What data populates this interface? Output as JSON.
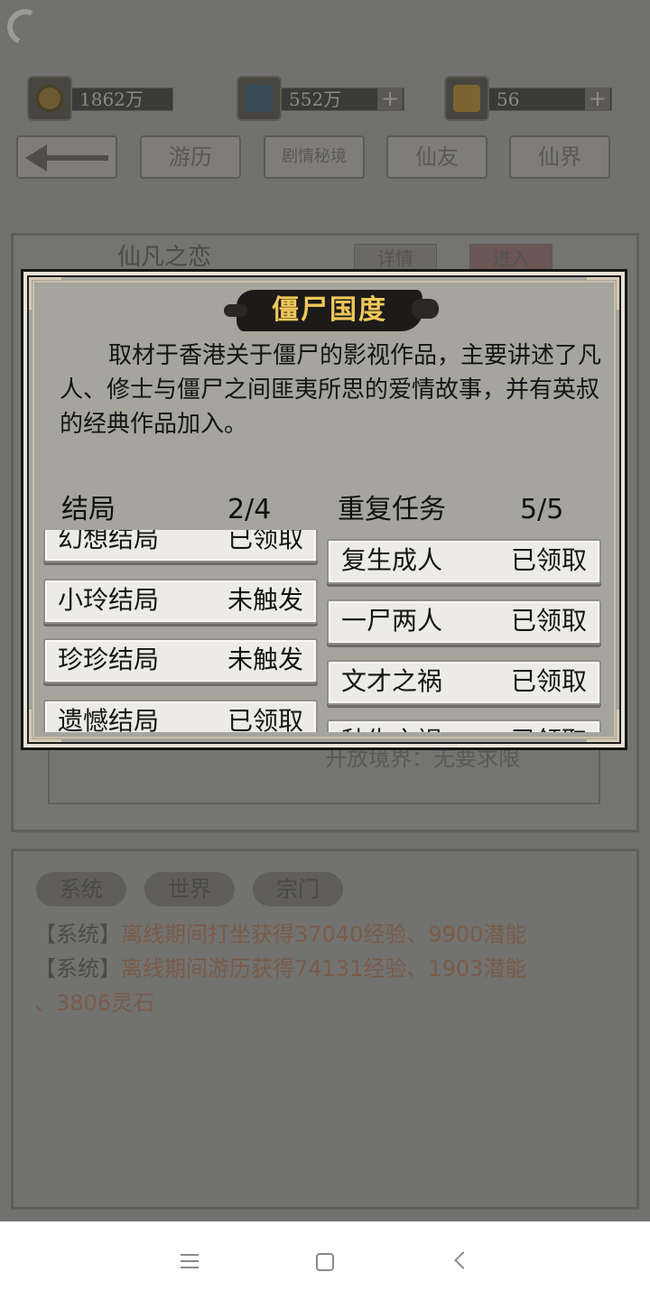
{
  "resources": [
    {
      "icon": "coin-icon",
      "value": "1862万"
    },
    {
      "icon": "sword-icon",
      "value": "552万",
      "plus": "+"
    },
    {
      "icon": "book-icon",
      "value": "56",
      "plus": "+"
    }
  ],
  "nav": {
    "back_icon": "left-arrow-icon",
    "tabs": [
      "游历",
      "剧情秘境",
      "仙友",
      "仙界"
    ]
  },
  "background_stage": {
    "title": "仙凡之恋",
    "details_button": "详情",
    "enter_button": "进入",
    "note": "开放境界：无要求限"
  },
  "chat": {
    "tabs": [
      "系统",
      "世界",
      "宗门"
    ],
    "lines": [
      {
        "tag": "【系统】",
        "text": "离线期间打坐获得37040经验、9900潜能"
      },
      {
        "tag": "【系统】",
        "text": "离线期间游历获得74131经验、1903潜能"
      },
      {
        "tag": "",
        "text": "、3806灵石"
      }
    ]
  },
  "modal": {
    "title": "僵尸国度",
    "description": "取材于香港关于僵尸的影视作品，主要讲述了凡人、修士与僵尸之间匪夷所思的爱情故事，并有英叔的经典作品加入。",
    "endings": {
      "label": "结局",
      "count": "2/4",
      "items": [
        {
          "name": "幻想结局",
          "status": "已领取"
        },
        {
          "name": "小玲结局",
          "status": "未触发"
        },
        {
          "name": "珍珍结局",
          "status": "未触发"
        },
        {
          "name": "遗憾结局",
          "status": "已领取"
        }
      ]
    },
    "repeat_tasks": {
      "label": "重复任务",
      "count": "5/5",
      "items": [
        {
          "name": "复生成人",
          "status": "已领取"
        },
        {
          "name": "一尸两人",
          "status": "已领取"
        },
        {
          "name": "文才之祸",
          "status": "已领取"
        },
        {
          "name": "秋生之祸",
          "status": "已领取"
        }
      ]
    }
  },
  "system_nav": [
    "menu-icon",
    "home-icon",
    "back-icon"
  ]
}
